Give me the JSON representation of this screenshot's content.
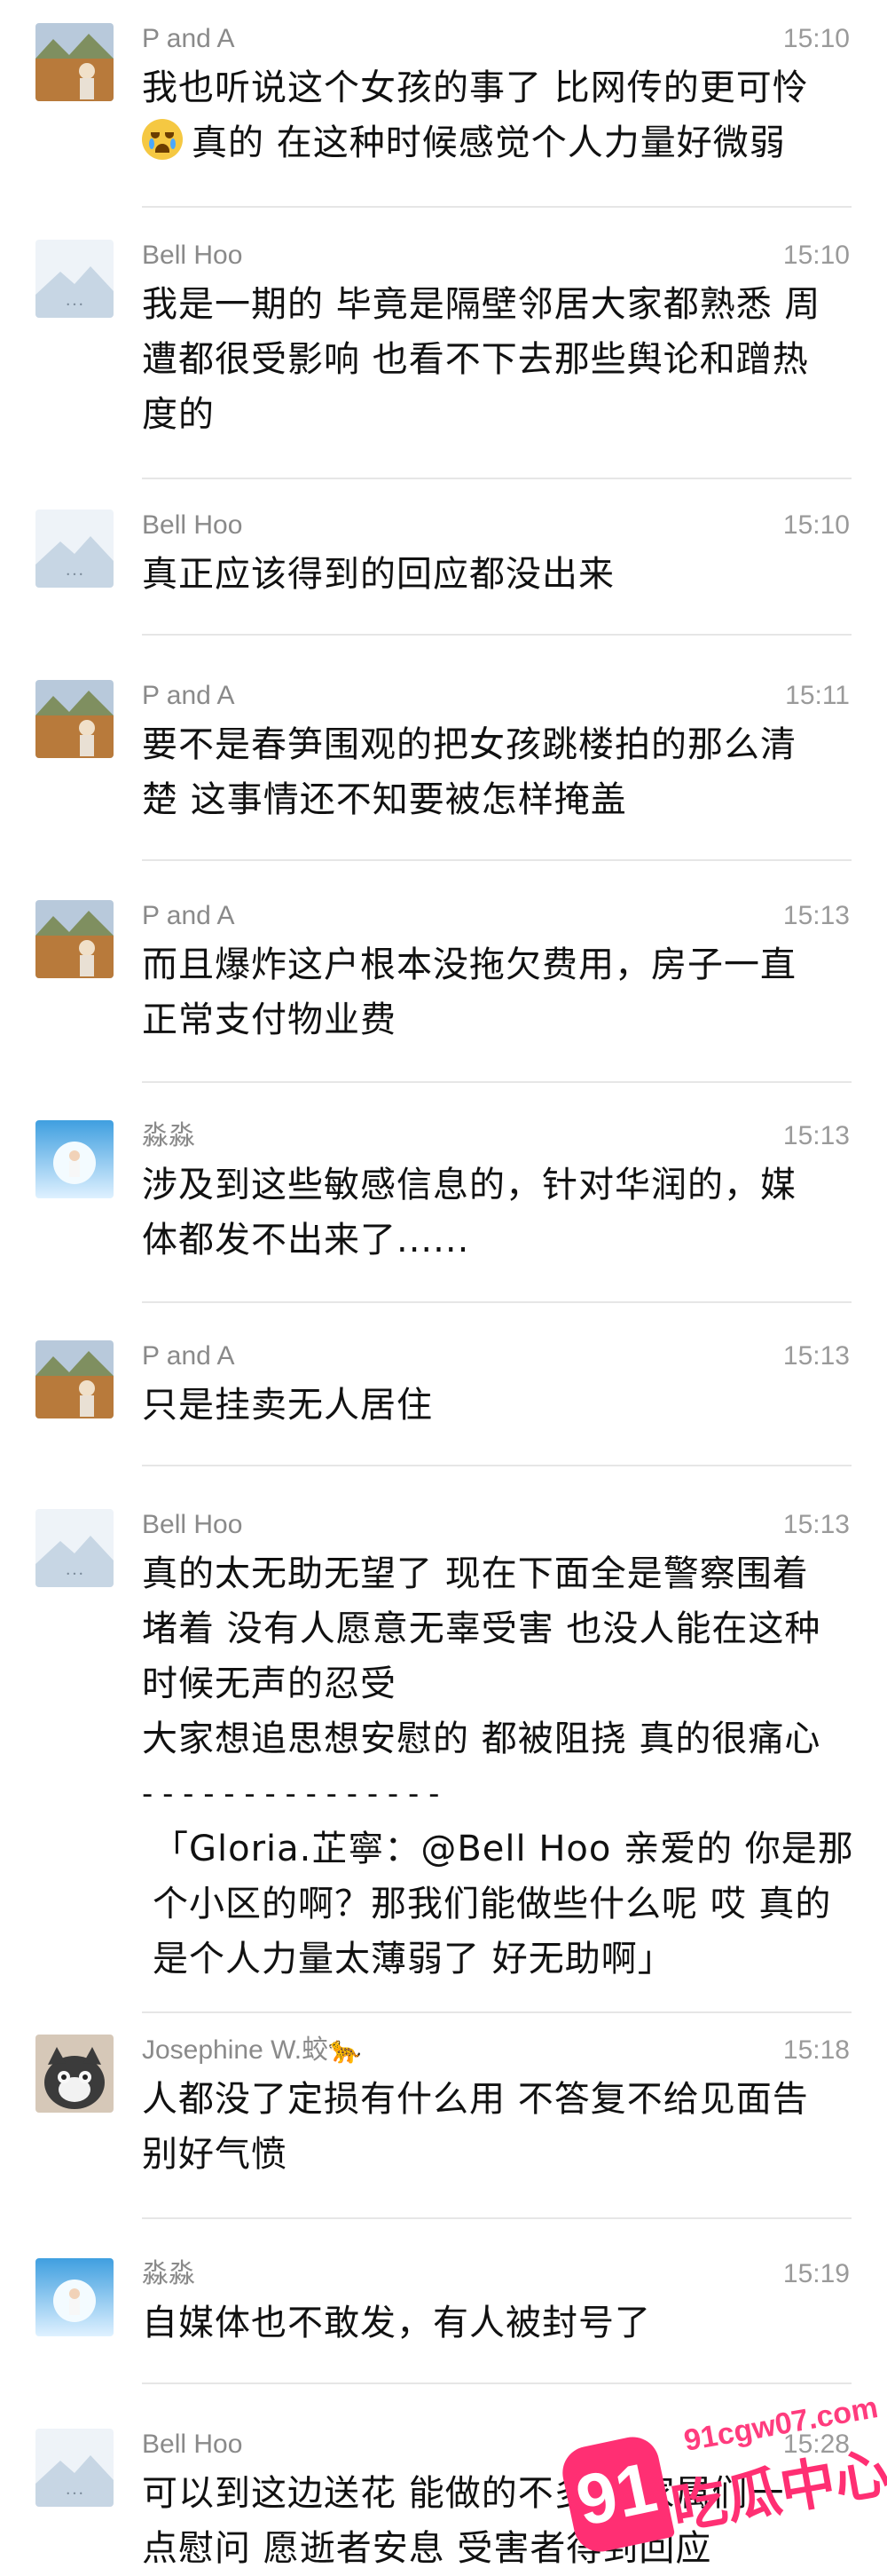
{
  "messages": [
    {
      "sender": "P and A",
      "time": "15:10",
      "avatar": "landscape-avatar",
      "lines": [
        "我也听说这个女孩的事了 比网传的更可怜",
        "真的 在这种时候感觉个人力量好微弱"
      ],
      "emoji": "loudly-crying-face"
    },
    {
      "sender": "Bell Hoo",
      "time": "15:10",
      "avatar": "mountain-avatar",
      "lines": [
        "我是一期的 毕竟是隔壁邻居大家都熟悉 周",
        "遭都很受影响 也看不下去那些舆论和蹭热",
        "度的"
      ]
    },
    {
      "sender": "Bell Hoo",
      "time": "15:10",
      "avatar": "mountain-avatar",
      "lines": [
        "真正应该得到的回应都没出来"
      ]
    },
    {
      "sender": "P and A",
      "time": "15:11",
      "avatar": "landscape-avatar",
      "lines": [
        "要不是春笋围观的把女孩跳楼拍的那么清",
        "楚 这事情还不知要被怎样掩盖"
      ]
    },
    {
      "sender": "P and A",
      "time": "15:13",
      "avatar": "landscape-avatar",
      "lines": [
        "而且爆炸这户根本没拖欠费用，房子一直",
        "正常支付物业费"
      ]
    },
    {
      "sender": "淼淼",
      "time": "15:13",
      "avatar": "sky-avatar",
      "lines": [
        "涉及到这些敏感信息的，针对华润的，媒",
        "体都发不出来了......"
      ]
    },
    {
      "sender": "P and A",
      "time": "15:13",
      "avatar": "landscape-avatar",
      "lines": [
        "只是挂卖无人居住"
      ]
    },
    {
      "sender": "Bell Hoo",
      "time": "15:13",
      "avatar": "mountain-avatar",
      "lines": [
        "真的太无助无望了 现在下面全是警察围着",
        "堵着 没有人愿意无辜受害 也没人能在这种",
        "时候无声的忍受",
        "大家想追思想安慰的 都被阻挠 真的很痛心"
      ],
      "separator": "- - - - - - - - - - - - - - -",
      "quote": [
        "「Gloria.芷寧：@Bell Hoo 亲爱的 你是那",
        "个小区的啊？那我们能做些什么呢 哎 真的",
        "是个人力量太薄弱了 好无助啊」"
      ]
    },
    {
      "sender": "Josephine W.蛟🐆",
      "time": "15:18",
      "avatar": "cat-avatar",
      "lines": [
        "人都没了定损有什么用 不答复不给见面告",
        "别好气愤"
      ]
    },
    {
      "sender": "淼淼",
      "time": "15:19",
      "avatar": "sky-avatar",
      "lines": [
        "自媒体也不敢发，有人被封号了"
      ]
    },
    {
      "sender": "Bell Hoo",
      "time": "15:28",
      "avatar": "mountain-avatar",
      "lines": [
        "可以到这边送花 能做的不多 给家属们一",
        "点慰问 愿逝者安息 受害者得到回应"
      ]
    }
  ],
  "watermark": {
    "url": "91cgw07.com",
    "logo": "91",
    "brand": "吃瓜中心"
  },
  "colors": {
    "name": "#8a8a8a",
    "time": "#9a9a9a",
    "divider": "#e6e6e6",
    "watermark": "#ff2f73"
  }
}
